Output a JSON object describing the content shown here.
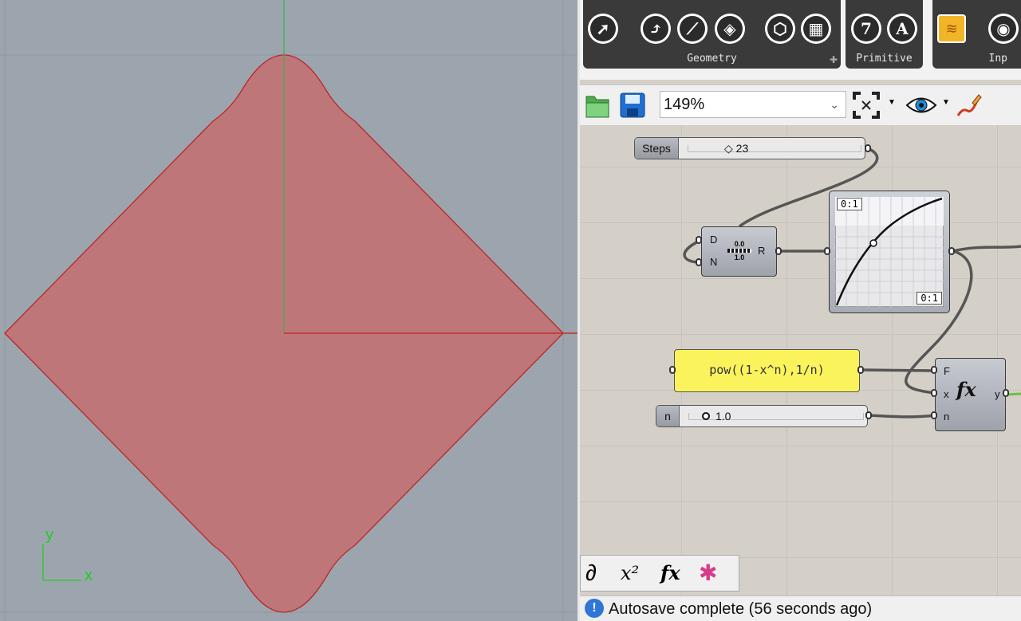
{
  "viewport": {
    "axis_y_label": "y",
    "axis_x_label": "x",
    "colors": {
      "fill": "#bf7679",
      "edge": "#b8282b",
      "x_axis": "#c0302f",
      "y_axis": "#3cb043",
      "background": "#9ca5ad"
    }
  },
  "ribbon": {
    "panels": [
      {
        "label": "Geometry"
      },
      {
        "label": "Primitive"
      },
      {
        "label": "Inp"
      }
    ],
    "buttons": {
      "seven": "7",
      "letter_a": "A"
    }
  },
  "toolbar": {
    "zoom": "149%",
    "icons": [
      "open-file-icon",
      "save-icon",
      "zoom-extents-icon",
      "preview-eye-icon",
      "sketch-pen-icon"
    ]
  },
  "canvas": {
    "steps_slider": {
      "label": "Steps",
      "value": "◇ 23"
    },
    "n_slider": {
      "label": "n",
      "value": "1.0"
    },
    "range_component": {
      "inputs": [
        "D",
        "N"
      ],
      "output": "R",
      "icon_top": "0.0",
      "icon_bottom": "1.0"
    },
    "graph_mapper": {
      "x_range": "0:1",
      "y_range": "0:1"
    },
    "expression_panel": "pow((1-x^n),1/n)",
    "evaluate": {
      "inputs": [
        "F",
        "x",
        "n"
      ],
      "output": "y"
    }
  },
  "bottombar": {
    "icons": [
      "math-tab-icon",
      "superscript-tab-icon",
      "function-tab-icon",
      "star-tab-icon"
    ]
  },
  "status": {
    "text": "Autosave complete (56 seconds ago)",
    "icon": "info-icon"
  }
}
